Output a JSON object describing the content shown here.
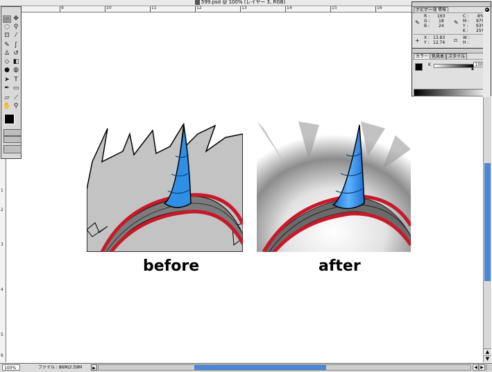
{
  "window": {
    "title": "599.psd @ 100% (レイヤー 3, RGB)"
  },
  "ruler": {
    "h_labels": [
      "9",
      "10",
      "11",
      "12",
      "13",
      "14",
      "15",
      "16"
    ],
    "v_labels": [
      "1",
      "2",
      "3",
      "4",
      "5",
      "6"
    ]
  },
  "toolbox": {
    "tools": [
      "marquee-tool",
      "move-tool",
      "lasso-tool",
      "magic-wand-tool",
      "crop-tool",
      "slice-tool",
      "healing-brush-tool",
      "brush-tool",
      "clone-stamp-tool",
      "history-brush-tool",
      "eraser-tool",
      "gradient-tool",
      "dodge-tool",
      "blur-tool",
      "path-select-tool",
      "type-tool",
      "pen-tool",
      "shape-tool",
      "notes-tool",
      "eyedropper-tool",
      "hand-tool",
      "zoom-tool"
    ]
  },
  "info_palette": {
    "tabs": [
      "ナビゲータ",
      "情報"
    ],
    "active_tab": "情報",
    "rgb": {
      "r_label": "R :",
      "r": "163",
      "g_label": "G :",
      "g": "18",
      "b_label": "B :",
      "b": "24"
    },
    "cmyk": {
      "c_label": "C :",
      "c": "8%",
      "m_label": "M :",
      "m": "97%",
      "y_label": "Y :",
      "y": "93%",
      "k_label": "K :",
      "k": "25%"
    },
    "xy": {
      "x_label": "X :",
      "x": "13.83",
      "y_label": "Y :",
      "y": "12.74"
    },
    "wh": {
      "w_label": "W :",
      "h_label": "H :"
    }
  },
  "color_palette": {
    "tabs": [
      "カラー",
      "色見本",
      "スタイル"
    ],
    "active_tab": "カラー",
    "k_label": "K",
    "k_value": "100",
    "k_unit": "%"
  },
  "canvas": {
    "before_label": "before",
    "after_label": "after"
  },
  "status": {
    "zoom": "100%",
    "file_info": "ファイル : 86M/2.59M"
  },
  "colors": {
    "horn": "#2f8fe6",
    "band_red": "#c8182a",
    "fur_gray": "#c3c3c3",
    "scroll_thumb": "#4a87d6"
  }
}
